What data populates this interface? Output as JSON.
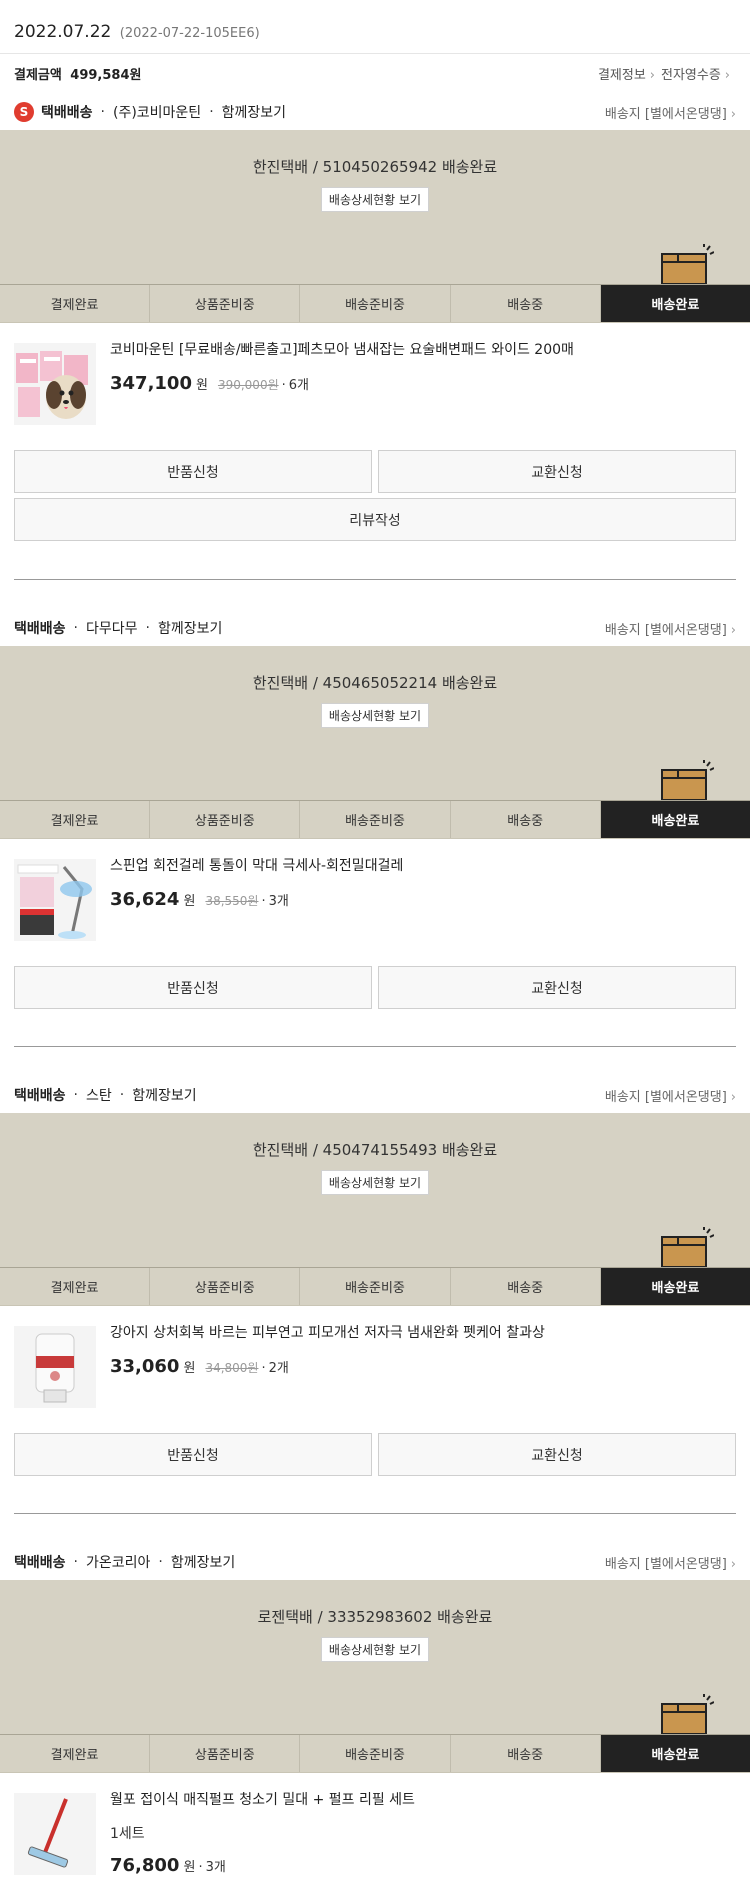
{
  "order": {
    "date": "2022.07.22",
    "id": "(2022-07-22-105EE6)",
    "pay_label": "결제금액",
    "pay_amount": "499,584원",
    "pay_info_link": "결제정보",
    "receipt_link": "전자영수증"
  },
  "steps": [
    "결제완료",
    "상품준비중",
    "배송준비중",
    "배송중",
    "배송완료"
  ],
  "detail_button": "배송상세현황 보기",
  "shipments": [
    {
      "badge": "S",
      "method": "택배배송",
      "seller": "(주)코비마운틴",
      "bundle": "함께장보기",
      "address": "배송지 [별에서온댕댕]",
      "tracking": "한진택배 / 510450265942 배송완료",
      "product": {
        "name": "코비마운틴 [무료배송/빠른출고]페츠모아 냄새잡는 요술배변패드 와이드 200매",
        "option": "",
        "price": "347,100",
        "won": "원",
        "original": "390,000원",
        "qty": "6개"
      },
      "buttons": [
        "반품신청",
        "교환신청"
      ],
      "review": "리뷰작성"
    },
    {
      "badge": "",
      "method": "택배배송",
      "seller": "다무다무",
      "bundle": "함께장보기",
      "address": "배송지 [별에서온댕댕]",
      "tracking": "한진택배 / 450465052214 배송완료",
      "product": {
        "name": "스핀업 회전걸레 통돌이 막대 극세사-회전밀대걸레",
        "option": "",
        "price": "36,624",
        "won": "원",
        "original": "38,550원",
        "qty": "3개"
      },
      "buttons": [
        "반품신청",
        "교환신청"
      ],
      "review": ""
    },
    {
      "badge": "",
      "method": "택배배송",
      "seller": "스탄",
      "bundle": "함께장보기",
      "address": "배송지 [별에서온댕댕]",
      "tracking": "한진택배 / 450474155493 배송완료",
      "product": {
        "name": "강아지 상처회복 바르는 피부연고 피모개선 저자극 냄새완화 펫케어 찰과상",
        "option": "",
        "price": "33,060",
        "won": "원",
        "original": "34,800원",
        "qty": "2개"
      },
      "buttons": [
        "반품신청",
        "교환신청"
      ],
      "review": ""
    },
    {
      "badge": "",
      "method": "택배배송",
      "seller": "가온코리아",
      "bundle": "함께장보기",
      "address": "배송지 [별에서온댕댕]",
      "tracking": "로젠택배 / 33352983602 배송완료",
      "product": {
        "name": "월포 접이식 매직펄프 청소기 밀대 + 펄프 리필 세트",
        "option": "1세트",
        "price": "76,800",
        "won": "원",
        "original": "",
        "qty": "3개"
      },
      "buttons": [],
      "review": ""
    }
  ]
}
